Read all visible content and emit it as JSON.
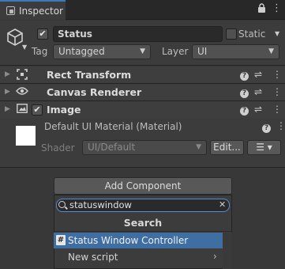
{
  "window": {
    "tab_title": "Inspector"
  },
  "object": {
    "active_checked": "✔",
    "name": "Status",
    "static_label": "Static",
    "tag_label": "Tag",
    "tag_value": "Untagged",
    "layer_label": "Layer",
    "layer_value": "UI"
  },
  "components": [
    {
      "title": "Rect Transform",
      "icon": "rect-transform-icon"
    },
    {
      "title": "Canvas Renderer",
      "icon": "eye-icon"
    },
    {
      "title": "Image",
      "icon": "image-icon",
      "enabled": "✔"
    }
  ],
  "material": {
    "name": "Default UI Material (Material)",
    "shader_label": "Shader",
    "shader_value": "UI/Default",
    "edit_button": "Edit...",
    "swatch_color": "#ffffff"
  },
  "add_component": {
    "button_label": "Add Component",
    "search_value": "statuswindow",
    "section_title": "Search",
    "items": [
      {
        "label": "Status Window Controller",
        "selected": true
      },
      {
        "label": "New script",
        "selected": false
      }
    ]
  },
  "colors": {
    "selection": "#3f6ea3",
    "tab_accent": "#3a79bb",
    "focus_border": "#5a8ad6"
  }
}
